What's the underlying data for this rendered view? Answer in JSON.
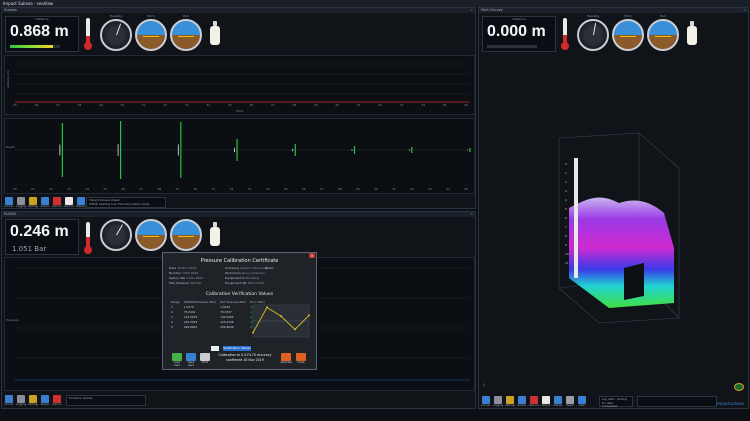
{
  "window": {
    "title": "Impact Subsea - seaView"
  },
  "left_top": {
    "header": "Subsea",
    "depth": {
      "label": "Distance",
      "value": "0.868 m",
      "bar_level": 0.85
    },
    "gauges": [
      {
        "label": "Heading"
      },
      {
        "label": "Pitch"
      },
      {
        "label": "Roll"
      }
    ],
    "thermometer_level": 0.35,
    "altitude_tick_labels": [
      "25",
      "26",
      "27",
      "28",
      "29",
      "30",
      "31",
      "32",
      "33",
      "34",
      "35",
      "36",
      "37",
      "38",
      "39",
      "40",
      "41",
      "42",
      "43",
      "44",
      "45",
      "46"
    ],
    "altitude_axis_title": "Time",
    "altitude_ylabel": "Altitude (m)",
    "profile_tick_labels": [
      "20",
      "21",
      "22",
      "23",
      "24",
      "25",
      "26",
      "27",
      "28",
      "29",
      "30",
      "31",
      "32",
      "33",
      "34",
      "35",
      "36",
      "37",
      "38",
      "39",
      "40",
      "41",
      "42",
      "43",
      "44",
      "45"
    ],
    "profile_ylabel": "Depth",
    "toolbar": [
      "Connect",
      "Logging",
      "Settings",
      "Sensor",
      "Disconnect",
      "Record",
      "Display",
      "Output"
    ],
    "status_text": "Impact Subsea Viewer\nISM3D heading tool: Firmware status ready",
    "colors": {
      "spike": "#27c23a",
      "limit_line": "#d03030"
    }
  },
  "left_bottom": {
    "header": "ISA500",
    "depth": {
      "value": "0.246 m",
      "sub": "1.051 Bar",
      "bar_level": 0.3
    },
    "gauges": [
      {
        "label": "Heading"
      },
      {
        "label": "Pitch"
      },
      {
        "label": "Roll"
      }
    ],
    "thermometer_level": 0.5,
    "ylabel": "Pressure",
    "toolbar": [
      "Connect",
      "Logging",
      "Settings",
      "Sensor",
      "Disconnect"
    ],
    "status_text": "Firmware update"
  },
  "dialog": {
    "title": "Pressure Calibration Certificate",
    "info_left": [
      [
        "Date",
        "18 Nov 2019"
      ],
      [
        "Number",
        "1502-0482"
      ],
      [
        "Option ISR",
        "0.001-2800"
      ],
      [
        "Max Pressure",
        "300 Bar"
      ]
    ],
    "info_right": [
      [
        "Company",
        "Impact Subsea Ltd"
      ],
      [
        "Technician",
        "Jenny Anderson"
      ],
      [
        "Equipment",
        "Budenberg"
      ],
      [
        "Equipment SN",
        "1002-1249"
      ]
    ],
    "notes_label": "Notes",
    "section_title": "Calibration Verification Values",
    "table_headers": [
      "Range",
      "ISR3000 Pressure (Bar)",
      "Ref. Pressure (Bar)",
      "Error (Bar)"
    ],
    "table_rows": [
      [
        "1",
        "1.0270",
        "1.0299",
        "-0.0029"
      ],
      [
        "2",
        "75.0491",
        "75.0457",
        "0.0034"
      ],
      [
        "3",
        "149.5076",
        "149.5064",
        "0.0012"
      ],
      [
        "4",
        "225.0425",
        "225.0446",
        "-0.0021"
      ],
      [
        "5",
        "299.8663",
        "299.8649",
        "0.0014"
      ]
    ],
    "verify_button": "Verification Values",
    "certification_text": "Calibration to 0.01% FS accuracy confirmed 18 Nov 2019",
    "buttons": [
      "Load Cert",
      "Save Cert",
      "Print",
      "Calibrate",
      "Close"
    ],
    "chart_data": {
      "type": "line",
      "x": [
        0,
        75,
        150,
        225,
        300
      ],
      "series": [
        {
          "values": [
            -0.0029,
            0.0034,
            0.0012,
            -0.0021,
            0.0014
          ]
        }
      ],
      "ylim": [
        -0.004,
        0.004
      ]
    }
  },
  "right": {
    "header": "Multi Survey",
    "depth": {
      "label": "Distance",
      "value": "0.000 m",
      "bar_level": 0.0
    },
    "gauges": [
      {
        "label": "Heading"
      },
      {
        "label": "Pitch"
      },
      {
        "label": "Roll"
      }
    ],
    "thermometer_level": 0.4,
    "depth_scale": [
      "0",
      "1",
      "2",
      "3",
      "4",
      "5",
      "6",
      "7",
      "8",
      "9",
      "10",
      "11"
    ],
    "toolbar": [
      "Connect",
      "Logging",
      "Settings",
      "Sensor",
      "Record",
      "Output",
      "Display",
      "Reset",
      "Help"
    ],
    "status_text": "Log data - waiting for data\nCompleted"
  },
  "brand": "impactsubsea"
}
